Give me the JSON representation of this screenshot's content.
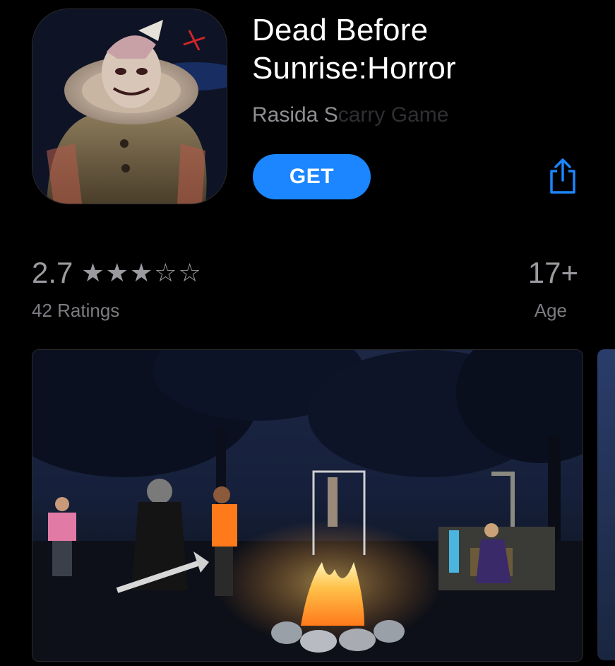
{
  "app": {
    "title": "Dead Before Sunrise:Horror",
    "developer_visible": "Rasida S",
    "developer_faded": "carry Game",
    "get_label": "GET"
  },
  "ratings": {
    "value": "2.7",
    "stars_filled": 3,
    "stars_total": 5,
    "count_label": "42 Ratings"
  },
  "age": {
    "value": "17+",
    "label": "Age"
  },
  "icons": {
    "share": "share-icon",
    "star_filled": "★",
    "star_empty": "☆"
  },
  "colors": {
    "accent": "#1b86ff",
    "background": "#000000",
    "secondary_text": "#8e8e93"
  }
}
